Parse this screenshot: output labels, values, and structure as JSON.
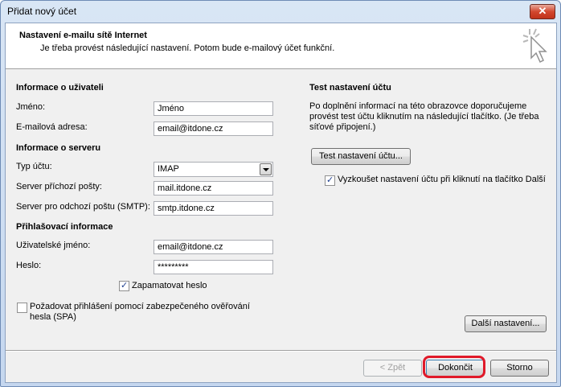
{
  "window": {
    "title": "Přidat nový účet",
    "close_glyph": "✕"
  },
  "header": {
    "title": "Nastavení e-mailu sítě Internet",
    "subtitle": "Je třeba provést následující nastavení. Potom bude e-mailový účet funkční.",
    "icon": "cursor-click-icon"
  },
  "user_info": {
    "section": "Informace o uživateli",
    "name_label": "Jméno:",
    "name_value": "Jméno",
    "email_label": "E-mailová adresa:",
    "email_value": "email@itdone.cz"
  },
  "server_info": {
    "section": "Informace o serveru",
    "type_label": "Typ účtu:",
    "type_value": "IMAP",
    "incoming_label": "Server příchozí pošty:",
    "incoming_value": "mail.itdone.cz",
    "outgoing_label": "Server pro odchozí poštu (SMTP):",
    "outgoing_value": "smtp.itdone.cz"
  },
  "login_info": {
    "section": "Přihlašovací informace",
    "username_label": "Uživatelské jméno:",
    "username_value": "email@itdone.cz",
    "password_label": "Heslo:",
    "password_value": "*********",
    "remember_label": "Zapamatovat heslo",
    "remember_checked": true,
    "spa_label": "Požadovat přihlášení pomocí zabezpečeného ověřování hesla (SPA)",
    "spa_checked": false
  },
  "test": {
    "section": "Test nastavení účtu",
    "description": "Po doplnění informací na této obrazovce doporučujeme provést test účtu kliknutím na následující tlačítko. (Je třeba síťové připojení.)",
    "button": "Test nastavení účtu...",
    "auto_test_label": "Vyzkoušet nastavení účtu při kliknutí na tlačítko Další",
    "auto_test_checked": true,
    "more_settings": "Další nastavení..."
  },
  "footer": {
    "back": "< Zpět",
    "finish": "Dokončit",
    "cancel": "Storno",
    "highlight_color": "#e01a2a"
  }
}
